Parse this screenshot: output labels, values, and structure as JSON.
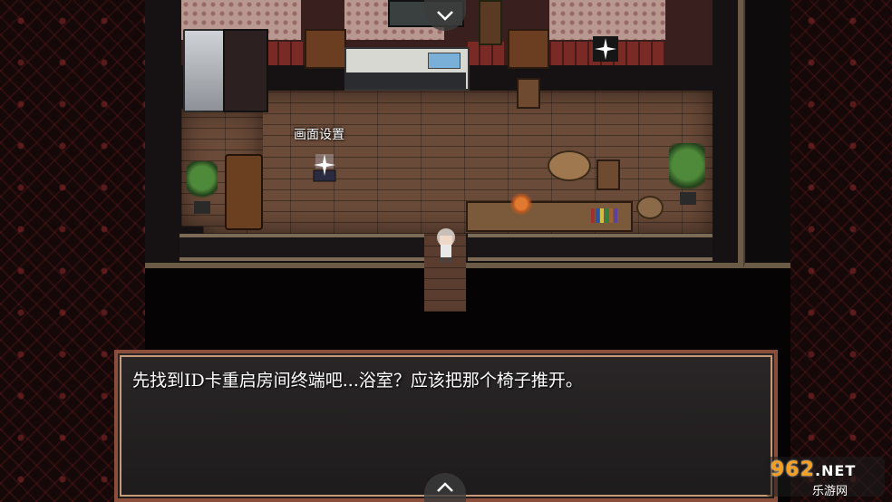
{
  "scene": {
    "map_label": "画面设置",
    "dialog_text": "先找到ID卡重启房间终端吧...浴室？应该把那个椅子推开。"
  },
  "controls": {
    "scroll_up_icon": "chevron-down-icon",
    "scroll_down_icon": "chevron-up-icon"
  },
  "watermark": {
    "number": "962",
    "domain": ".NET",
    "site_name": "乐游网"
  },
  "colors": {
    "dialog_border": "#8a4e3a",
    "dialog_bg": "#2a2627",
    "floor": "#6a4a38",
    "watermark_accent": "#f6a021"
  }
}
